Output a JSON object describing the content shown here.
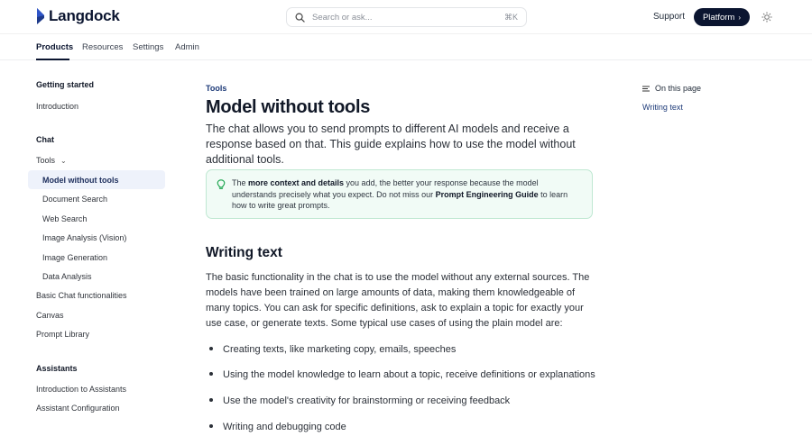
{
  "brand": {
    "name": "Langdock"
  },
  "search": {
    "placeholder": "Search or ask...",
    "shortcut": "⌘K"
  },
  "header": {
    "support_label": "Support",
    "platform_label": "Platform"
  },
  "tabs": [
    {
      "label": "Products",
      "active": true
    },
    {
      "label": "Resources"
    },
    {
      "label": "Settings"
    },
    {
      "label": "Admin"
    }
  ],
  "sidebar": {
    "getting_started": {
      "heading": "Getting started",
      "items": [
        "Introduction"
      ]
    },
    "chat": {
      "heading": "Chat",
      "tools_label": "Tools",
      "tools_items": [
        "Model without tools",
        "Document Search",
        "Web Search",
        "Image Analysis (Vision)",
        "Image Generation",
        "Data Analysis"
      ],
      "items": [
        "Basic Chat functionalities",
        "Canvas",
        "Prompt Library"
      ]
    },
    "assistants": {
      "heading": "Assistants",
      "items": [
        "Introduction to Assistants",
        "Assistant Configuration"
      ]
    }
  },
  "article": {
    "breadcrumb": "Tools",
    "title": "Model without tools",
    "lead": "The chat allows you to send prompts to different AI models and receive a response based on that. This guide explains how to use the model without additional tools.",
    "callout": {
      "pre": "The ",
      "bold1": "more context and details",
      "mid": " you add, the better your response because the model understands precisely what you expect. Do not miss our ",
      "bold2": "Prompt Engineering Guide",
      "post": " to learn how to write great prompts."
    },
    "section_title": "Writing text",
    "paragraph": "The basic functionality in the chat is to use the model without any external sources. The models have been trained on large amounts of data, making them knowledgeable of many topics. You can ask for specific definitions, ask to explain a topic for exactly your use case, or generate texts. Some typical use cases of using the plain model are:",
    "bullets": [
      "Creating texts, like marketing copy, emails, speeches",
      "Using the model knowledge to learn about a topic, receive definitions or explanations",
      "Use the model's creativity for brainstorming or receiving feedback",
      "Writing and debugging code"
    ]
  },
  "on_this_page": {
    "heading": "On this page",
    "links": [
      "Writing text"
    ]
  },
  "colors": {
    "accent": "#0b1530",
    "link": "#1d3a78",
    "callout_bg": "#f1fbf6",
    "callout_border": "#bfe8d2",
    "callout_icon": "#16a34a"
  }
}
